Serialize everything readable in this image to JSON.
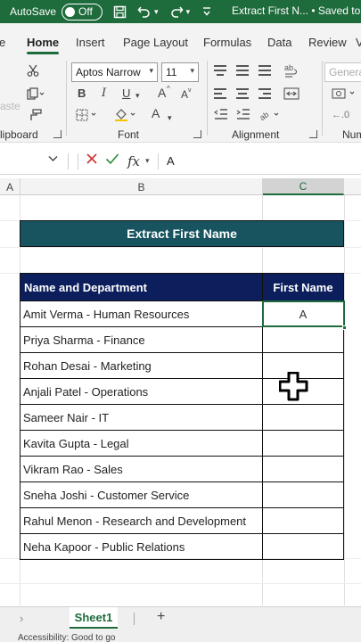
{
  "titlebar": {
    "autosave_label": "AutoSave",
    "toggle_state": "Off",
    "doc_title": "Extract First N... • Saved to t"
  },
  "ribbon_tabs": [
    {
      "label": "e"
    },
    {
      "label": "Home"
    },
    {
      "label": "Insert"
    },
    {
      "label": "Page Layout"
    },
    {
      "label": "Formulas"
    },
    {
      "label": "Data"
    },
    {
      "label": "Review"
    },
    {
      "label": "V"
    }
  ],
  "ribbon": {
    "paste_label": "aste",
    "font_name": "Aptos Narrow",
    "font_size": "11",
    "number_format": "Genera",
    "bold": "B",
    "italic": "I",
    "underline": "U",
    "grow_font": "A",
    "shrink_font": "A",
    "font_color": "A",
    "groups": {
      "clipboard": "lipboard",
      "font": "Font",
      "alignment": "Alignment",
      "number": "Num"
    }
  },
  "formula_bar": {
    "fx": "fx",
    "content": "A"
  },
  "columns": [
    "A",
    "B",
    "C"
  ],
  "sheet": {
    "title": "Extract First Name",
    "headers": [
      "Name and Department",
      "First Name"
    ],
    "rows": [
      {
        "name_dept": "Amit Verma - Human Resources",
        "first": "A"
      },
      {
        "name_dept": "Priya Sharma - Finance",
        "first": ""
      },
      {
        "name_dept": "Rohan Desai - Marketing",
        "first": ""
      },
      {
        "name_dept": "Anjali Patel - Operations",
        "first": ""
      },
      {
        "name_dept": "Sameer Nair - IT",
        "first": ""
      },
      {
        "name_dept": "Kavita Gupta - Legal",
        "first": ""
      },
      {
        "name_dept": "Vikram Rao - Sales",
        "first": ""
      },
      {
        "name_dept": "Sneha Joshi - Customer Service",
        "first": ""
      },
      {
        "name_dept": "Rahul Menon - Research and Development",
        "first": ""
      },
      {
        "name_dept": "Neha Kapoor - Public Relations",
        "first": ""
      }
    ]
  },
  "sheet_tabs": {
    "active": "Sheet1",
    "add": "+"
  },
  "status": {
    "text": "Accessibility: Good to go"
  },
  "colors": {
    "brand": "#1e6b3c",
    "banner": "#17545f",
    "header": "#0c1f5c"
  }
}
